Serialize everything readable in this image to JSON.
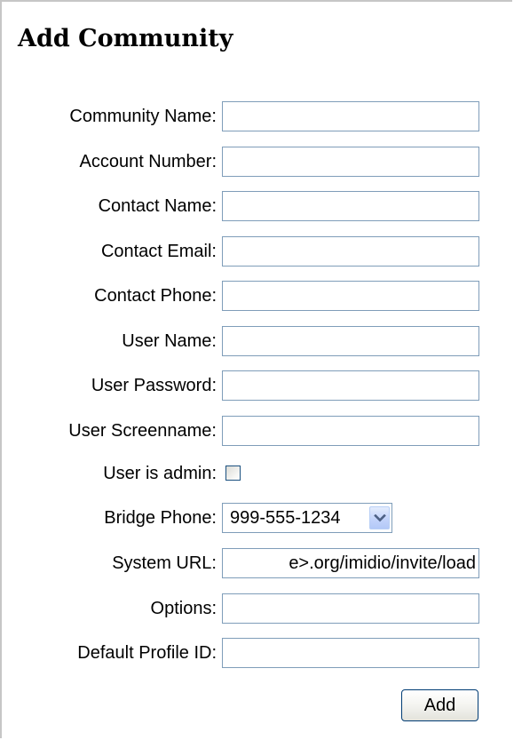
{
  "page": {
    "title": "Add Community"
  },
  "form": {
    "fields": [
      {
        "label": "Community Name:",
        "value": ""
      },
      {
        "label": "Account Number:",
        "value": ""
      },
      {
        "label": "Contact Name:",
        "value": ""
      },
      {
        "label": "Contact Email:",
        "value": ""
      },
      {
        "label": "Contact Phone:",
        "value": ""
      },
      {
        "label": "User Name:",
        "value": ""
      },
      {
        "label": "User Password:",
        "value": ""
      },
      {
        "label": "User Screenname:",
        "value": ""
      },
      {
        "label": "User is admin:",
        "checked": false
      },
      {
        "label": "Bridge Phone:",
        "selected": "999-555-1234"
      },
      {
        "label": "System URL:",
        "value": "e>.org/imidio/invite/load"
      },
      {
        "label": "Options:",
        "value": ""
      },
      {
        "label": "Default Profile ID:",
        "value": ""
      }
    ],
    "submit_label": "Add"
  },
  "icons": {
    "dropdown": "chevron-down-icon"
  },
  "colors": {
    "input_border": "#7f9db9",
    "frame_border": "#c6c6c6",
    "button_border": "#003c74",
    "dropdown_button": "#c3d4fb",
    "chevron": "#4d6185"
  }
}
